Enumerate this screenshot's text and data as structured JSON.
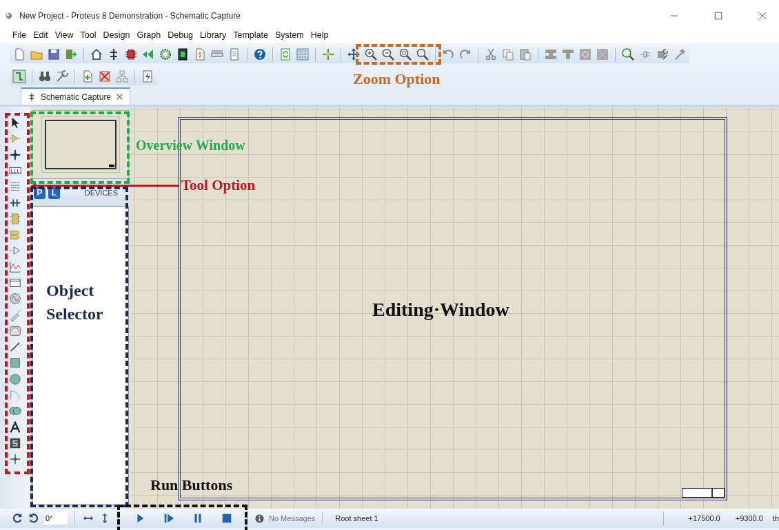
{
  "window": {
    "title": "New Project - Proteus 8 Demonstration - Schematic Capture"
  },
  "menu": [
    "File",
    "Edit",
    "View",
    "Tool",
    "Design",
    "Graph",
    "Debug",
    "Library",
    "Template",
    "System",
    "Help"
  ],
  "tabs": [
    {
      "label": "Schematic Capture",
      "selected": true
    }
  ],
  "object_selector": {
    "mode_buttons": [
      {
        "label": "P",
        "selected": false
      },
      {
        "label": "L",
        "selected": false
      }
    ],
    "title": "DEVICES"
  },
  "status_bar": {
    "angle": "0°",
    "messages": "No Messages",
    "sheet": "Root sheet 1",
    "x_coordinate": "+17500.0",
    "y_coordinate": "+9300.0",
    "unit": "th"
  },
  "annotations": [
    {
      "kind": "zoom",
      "label": "Zoom Option",
      "color": "#c8691e"
    },
    {
      "kind": "overview",
      "label": "Overview Window",
      "color": "#22a94a"
    },
    {
      "kind": "tools",
      "label": "Tool Option",
      "color": "#c0161f"
    },
    {
      "kind": "selector",
      "label": "Object Selector",
      "color": "#1b2a55"
    },
    {
      "kind": "editing",
      "label": "Editing·Window",
      "color": "#111111"
    },
    {
      "kind": "run",
      "label": "Run Buttons",
      "color": "#111111"
    }
  ]
}
